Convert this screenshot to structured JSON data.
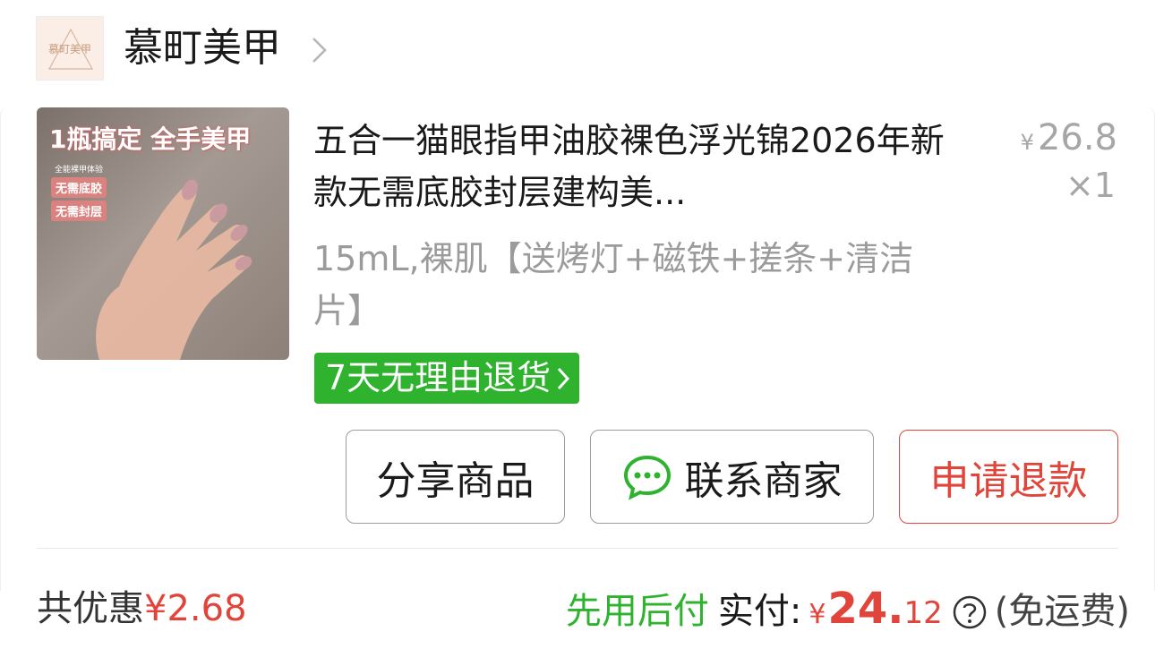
{
  "shop": {
    "name": "慕町美甲",
    "logo_text": "慕町美甲"
  },
  "product": {
    "title": "五合一猫眼指甲油胶裸色浮光锦2026年新款无需底胶封层建构美...",
    "spec": "15mL,裸肌【送烤灯+磁铁+搓条+清洁片】",
    "price_currency": "¥",
    "price": "26.8",
    "quantity": "×1",
    "thumbnail": {
      "headline": "1瓶搞定 全手美甲",
      "small_text": "全能裸甲体验",
      "tag1": "无需底胶",
      "tag2": "无需封层"
    },
    "return_badge": "7天无理由退货"
  },
  "actions": {
    "share": "分享商品",
    "contact": "联系商家",
    "refund": "申请退款"
  },
  "summary": {
    "discount_label": "共优惠",
    "discount_amount": "¥2.68",
    "bnpl": "先用后付",
    "paid_label": "实付:",
    "paid_currency": "¥",
    "paid_int": "24.",
    "paid_dec": "12",
    "shipping": "(免运费)"
  },
  "colors": {
    "accent_red": "#e0443a",
    "accent_green": "#2fb32f",
    "muted_text": "#9b9b9b"
  }
}
